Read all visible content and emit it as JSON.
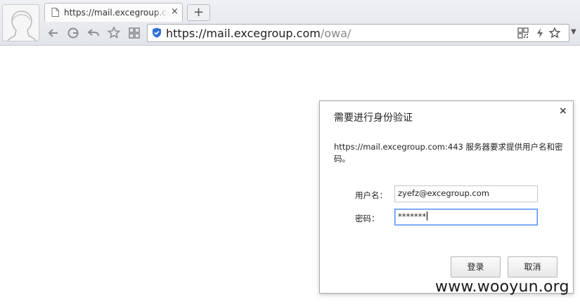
{
  "browser": {
    "tab_title": "https://mail.excegroup.com/owa/",
    "url_host": "https://mail.excegroup.com",
    "url_path": "/owa/",
    "new_tab_label": "+",
    "tab_close": "×",
    "icons": [
      "user-avatar-icon",
      "page-icon",
      "back-icon",
      "reload-icon",
      "undo-icon",
      "star-icon",
      "extensions-icon",
      "shield-icon",
      "qr-icon",
      "lightning-icon",
      "bookmark-star-icon",
      "menu-arrow-icon"
    ]
  },
  "dialog": {
    "title": "需要进行身份验证",
    "close": "×",
    "message": "https://mail.excegroup.com:443 服务器要求提供用户名和密码。",
    "username_label": "用户名：",
    "username_value": "zyefz@excegroup.com",
    "password_label": "密码：",
    "password_value": "*******",
    "login_button": "登录",
    "cancel_button": "取消"
  },
  "watermark": "www.wooyun.org"
}
